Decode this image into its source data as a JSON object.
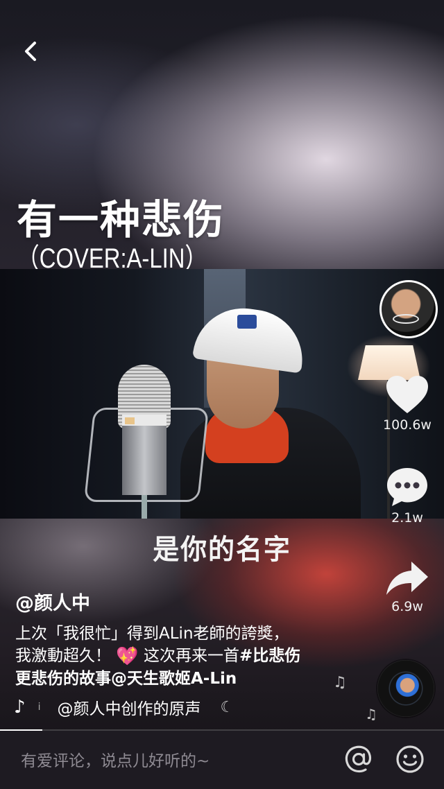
{
  "header": {
    "back_icon": "chevron-left-icon"
  },
  "video": {
    "title": "有一种悲伤",
    "subtitle": "（COVER:A-LIN）",
    "lyric": "是你的名字"
  },
  "sidebar": {
    "like_count": "100.6w",
    "comment_count": "2.1w",
    "share_count": "6.9w"
  },
  "post": {
    "username": "@颜人中",
    "description_line1": "上次「我很忙」得到ALin老師的誇獎，",
    "description_line2a": "我激動超久！",
    "description_line2b": " 这次再来一首",
    "hashtag": "#比悲伤",
    "description_line3a": "更悲伤的故事",
    "mention": "@天生歌姬A-Lin",
    "music_label": "@颜人中创作的原声"
  },
  "comment_bar": {
    "placeholder": "有爱评论，说点儿好听的~"
  },
  "progress": {
    "fraction": 0.095
  },
  "colors": {
    "accent_heart": "#f2f2f2",
    "sparkle_heart": "#f04aa5",
    "progress_fill": "#ffffff"
  }
}
